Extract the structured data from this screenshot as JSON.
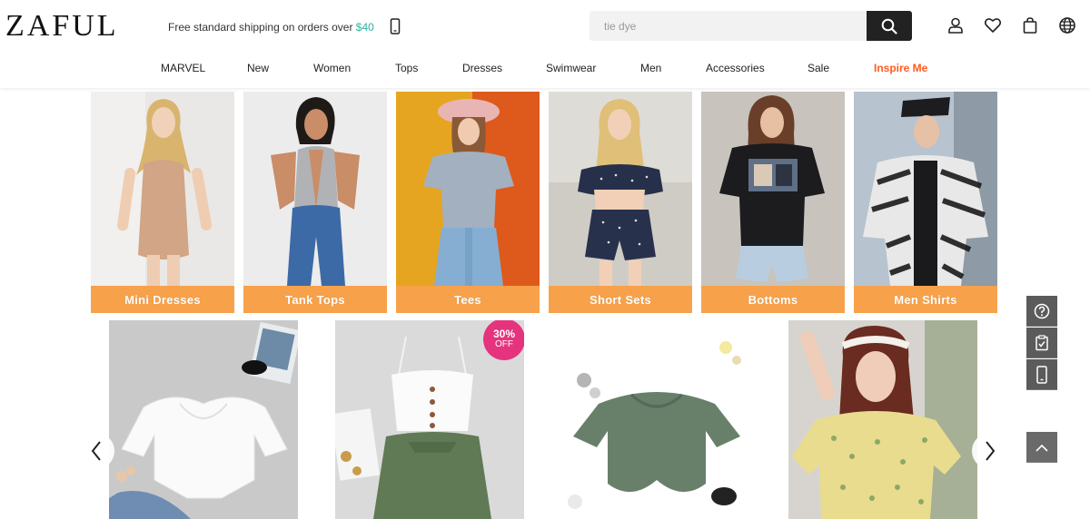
{
  "brand": {
    "logo": "ZAFUL"
  },
  "promo": {
    "text": "Free standard shipping on orders over ",
    "amount": "$40"
  },
  "search": {
    "placeholder": "tie dye"
  },
  "header_icons": [
    "search-icon",
    "user-icon",
    "heart-icon",
    "bag-icon",
    "globe-icon",
    "phone-icon"
  ],
  "nav": {
    "items": [
      "MARVEL",
      "New",
      "Women",
      "Tops",
      "Dresses",
      "Swimwear",
      "Men",
      "Accessories",
      "Sale",
      "Inspire Me"
    ],
    "accent_color": "#ff5a1f"
  },
  "categories": [
    {
      "label": "Mini Dresses"
    },
    {
      "label": "Tank Tops"
    },
    {
      "label": "Tees"
    },
    {
      "label": "Short Sets"
    },
    {
      "label": "Bottoms"
    },
    {
      "label": "Men Shirts"
    }
  ],
  "category_bar_color": "#f7a14b",
  "products": [
    {
      "name": "white-blouse"
    },
    {
      "name": "cami-top-skirt-set",
      "badge": {
        "percent": "30%",
        "off": "OFF"
      }
    },
    {
      "name": "olive-crop-tee"
    },
    {
      "name": "floral-blouse"
    }
  ],
  "badge_color": "#e5337d",
  "side_toolbar": [
    "help-icon",
    "checklist-icon",
    "mobile-icon",
    "back-to-top-icon"
  ],
  "colors": {
    "promo_amount": "#2bb3a3",
    "search_button": "#222222",
    "toolbar": "#5b5b5b"
  }
}
